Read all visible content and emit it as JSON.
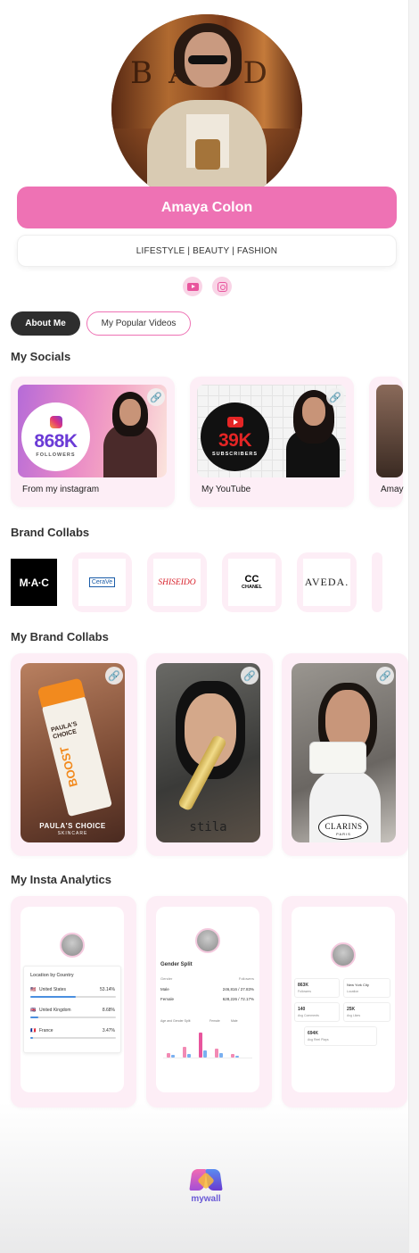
{
  "profile": {
    "name": "Amaya Colon",
    "tagline": "LIFESTYLE | BEAUTY | FASHION",
    "avatar_sign": "BAPD"
  },
  "social_links": [
    {
      "icon": "youtube-icon"
    },
    {
      "icon": "instagram-icon"
    }
  ],
  "tabs": [
    {
      "label": "About Me",
      "active": true
    },
    {
      "label": "My Popular Videos",
      "active": false
    }
  ],
  "sections": {
    "socials": "My Socials",
    "brand_collabs": "Brand Collabs",
    "my_brand_collabs": "My Brand Collabs",
    "insta_analytics": "My Insta Analytics"
  },
  "socials": [
    {
      "caption": "From my instagram",
      "count": "868K",
      "unit": "FOLLOWERS",
      "platform": "instagram"
    },
    {
      "caption": "My YouTube",
      "count": "39K",
      "unit": "SUBSCRIBERS",
      "platform": "youtube"
    },
    {
      "caption": "Amay",
      "platform": "tiktok"
    }
  ],
  "brand_logos": [
    {
      "name": "MAC",
      "text": "M·A·C"
    },
    {
      "name": "CeraVe",
      "text": "CeraVe"
    },
    {
      "name": "Shiseido",
      "text": "SHISEIDO"
    },
    {
      "name": "Chanel",
      "mark": "CC",
      "text": "CHANEL"
    },
    {
      "name": "Aveda",
      "text": "AVEDA."
    }
  ],
  "brand_videos": [
    {
      "brand": "PAULA'S CHOICE",
      "sub": "SKINCARE",
      "product": "PAULA'S CHOICE",
      "label": "BOOST"
    },
    {
      "brand": "stila"
    },
    {
      "brand": "CLARINS",
      "sub": "PARIS"
    }
  ],
  "analytics": {
    "card1": {
      "title": "Location by Country",
      "rows": [
        {
          "country": "United States",
          "value": "53.14%",
          "fill": 0.53
        },
        {
          "country": "United Kingdom",
          "value": "8.68%",
          "fill": 0.09
        },
        {
          "country": "France",
          "value": "3.47%",
          "fill": 0.03
        }
      ]
    },
    "card2": {
      "title": "Gender Split",
      "header_left": "Gender",
      "header_right": "Followers",
      "rows": [
        {
          "label": "Male",
          "value": "246,816 / 27.83%"
        },
        {
          "label": "Female",
          "value": "628,226 / 72.17%"
        }
      ],
      "chart_title": "Age and Gender Split",
      "legend": [
        "Female",
        "Male"
      ]
    },
    "card3": {
      "tiles": [
        {
          "value": "863K",
          "label": "Followers"
        },
        {
          "value": "New York City",
          "label": "Location"
        },
        {
          "value": "140",
          "label": "Avg Comments"
        },
        {
          "value": "25K",
          "label": "Avg Likes"
        },
        {
          "value": "694K",
          "label": "Avg Reel Plays"
        }
      ]
    }
  },
  "footer": {
    "brand": "mywall"
  },
  "colors": {
    "accent": "#ee72b4",
    "card_bg": "#fdeef6",
    "dark_tab": "#2e2e2e"
  }
}
